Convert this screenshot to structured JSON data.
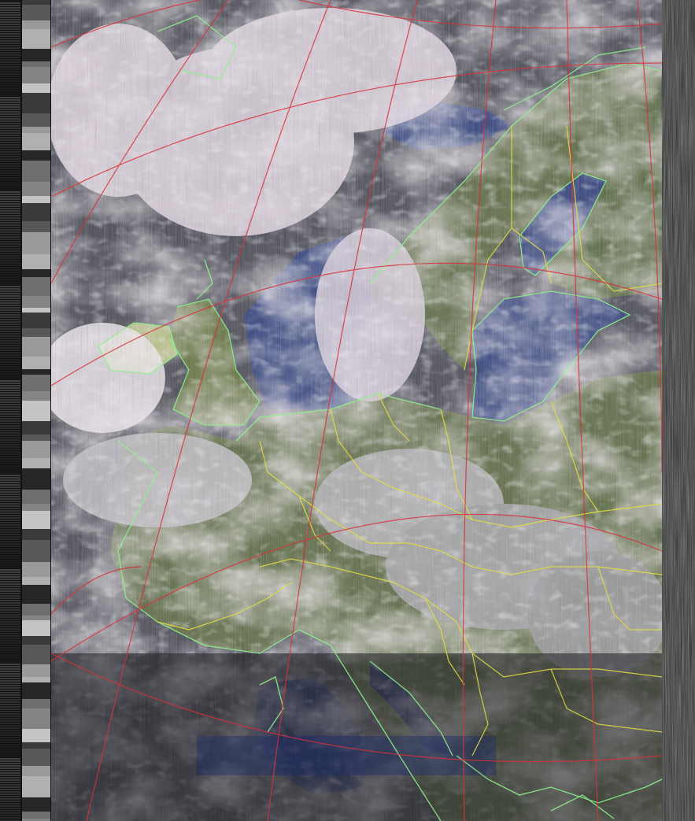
{
  "image": {
    "kind": "satellite-weather-image",
    "overlays": [
      "graticule",
      "coastlines",
      "country-borders"
    ]
  },
  "colors": {
    "graticule": "#d8323a",
    "coastline": "#8ef08e",
    "border": "#e6e040",
    "sea": "#2f3f7a",
    "land": "#5b6b3c",
    "cloud": "#e8dde6",
    "noise_dark": "#2a2a2a",
    "noise_light": "#9a9a9a",
    "sync_bar_dark": "#111111",
    "sync_bar_light": "#bbbbbb"
  }
}
